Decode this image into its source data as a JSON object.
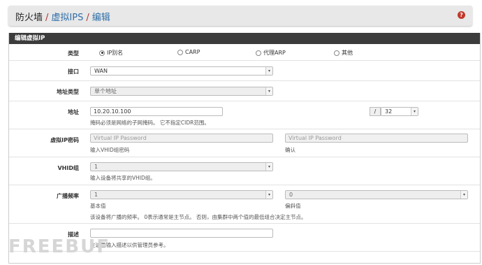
{
  "breadcrumb": {
    "part1": "防火墙",
    "sep": "/",
    "part2": "虚拟IPS",
    "part3": "编辑"
  },
  "help_icon": "?",
  "panel": {
    "title": "编辑虚拟IP"
  },
  "type_row": {
    "label": "类型",
    "options": [
      "IP别名",
      "CARP",
      "代理ARP",
      "其他"
    ],
    "selected": "IP别名"
  },
  "interface_row": {
    "label": "接口",
    "value": "WAN"
  },
  "addrtype_row": {
    "label": "地址类型",
    "value": "单个地址"
  },
  "address_row": {
    "label": "地址",
    "value": "10.20.10.100",
    "slash": "/",
    "mask": "32",
    "help": "掩码必须是网络的子网掩码。 它不指定CIDR范围。"
  },
  "password_row": {
    "label": "虚拟IP密码",
    "placeholder1": "Virtual IP Password",
    "help1": "输入VHID组密码",
    "placeholder2": "Virtual IP Password",
    "help2": "确认"
  },
  "vhid_row": {
    "label": "VHID组",
    "value": "1",
    "help": "输入设备将共享的VHID组。"
  },
  "adv_row": {
    "label": "广播频率",
    "base": "1",
    "base_help": "基本值",
    "skew": "0",
    "skew_help": "偏斜值",
    "help": "该设备将广播的频率。 0表示通常是主节点。 否则，由集群中两个值的最低组合决定主节点。"
  },
  "desc_row": {
    "label": "描述",
    "value": "",
    "help": "在这里输入描述以供管理员参考。"
  },
  "watermark": "FREEBUF"
}
